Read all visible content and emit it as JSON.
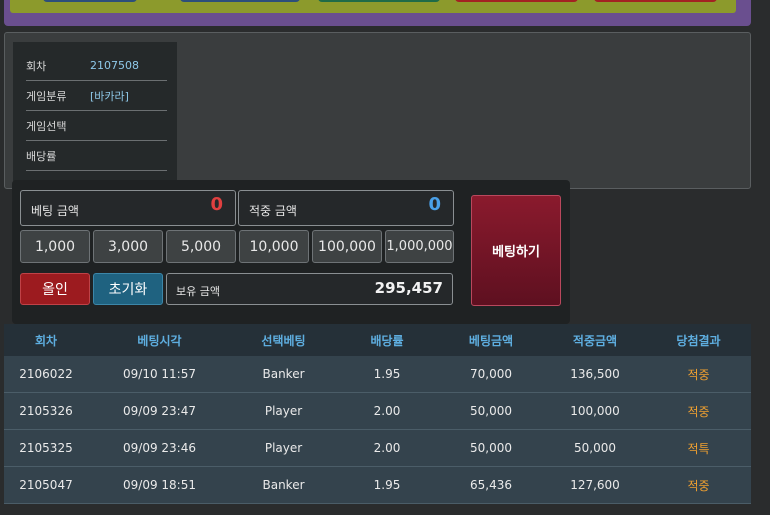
{
  "info": {
    "rows": [
      {
        "label": "회차",
        "value": "2107508"
      },
      {
        "label": "게임분류",
        "value": "[바카라]"
      },
      {
        "label": "게임선택",
        "value": ""
      },
      {
        "label": "배당률",
        "value": ""
      }
    ]
  },
  "bet": {
    "bet_amount_label": "베팅 금액",
    "bet_amount_value": "0",
    "win_amount_label": "적중 금액",
    "win_amount_value": "0",
    "chips": [
      "1,000",
      "3,000",
      "5,000",
      "10,000",
      "100,000",
      "1,000,000"
    ],
    "allin_label": "올인",
    "reset_label": "초기화",
    "holding_label": "보유 금액",
    "holding_value": "295,457",
    "submit_label": "베팅하기"
  },
  "table": {
    "headers": [
      "회차",
      "베팅시각",
      "선택베팅",
      "배당률",
      "베팅금액",
      "적중금액",
      "당첨결과"
    ],
    "rows": [
      [
        "2106022",
        "09/10 11:57",
        "Banker",
        "1.95",
        "70,000",
        "136,500",
        "적중"
      ],
      [
        "2105326",
        "09/09 23:47",
        "Player",
        "2.00",
        "50,000",
        "100,000",
        "적중"
      ],
      [
        "2105325",
        "09/09 23:46",
        "Player",
        "2.00",
        "50,000",
        "50,000",
        "적특"
      ],
      [
        "2105047",
        "09/09 18:51",
        "Banker",
        "1.95",
        "65,436",
        "127,600",
        "적중"
      ]
    ]
  },
  "colors": {
    "bet_value": "#e04040",
    "win_value": "#4aa0e8",
    "result": "#f0a030",
    "header_text": "#5eaee0"
  }
}
